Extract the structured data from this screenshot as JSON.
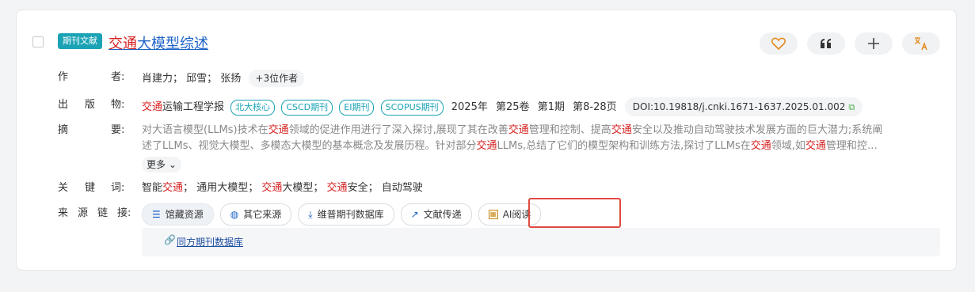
{
  "doc_type": "期刊文献",
  "title": {
    "hl": "交通",
    "rest": "大模型综述"
  },
  "actions": [
    {
      "name": "favorite-icon"
    },
    {
      "name": "quote-icon"
    },
    {
      "name": "add-icon"
    },
    {
      "name": "translate-icon"
    }
  ],
  "labels": {
    "author": [
      "作",
      "者:"
    ],
    "publisher": [
      "出",
      "版",
      "物:"
    ],
    "abstract": [
      "摘",
      "要:"
    ],
    "keywords": [
      "关",
      "键",
      "词:"
    ],
    "sources": [
      "来",
      "源",
      "链",
      "接:"
    ]
  },
  "authors": {
    "list": "肖建力； 邱雪； 张扬",
    "more": "+3位作者"
  },
  "publication": {
    "journal_hl": "交通",
    "journal_rest": "运输工程学报",
    "tags": [
      "北大核心",
      "CSCD期刊",
      "EI期刊",
      "SCOPUS期刊"
    ],
    "year": "2025年",
    "volume": "第25卷",
    "issue": "第1期",
    "pages": "第8-28页",
    "doi": "DOI:10.19818/j.cnki.1671-1637.2025.01.002"
  },
  "abstract": {
    "line1_a": "对大语言模型(LLMs)技术在",
    "hl": "交通",
    "line1_b": "领域的促进作用进行了深入探讨,展现了其在改善",
    "line1_c": "管理和控制、提高",
    "line1_d": "安全以及推动自动驾驶技术发展方面的巨大潜力;系统阐",
    "line2_a": "述了LLMs、视觉大模型、多模态大模型的基本概念及发展历程。针对部分",
    "line2_b": "LLMs,总结了它们的模型架构和训练方法,探讨了LLMs在",
    "line2_c": "领域,如",
    "line2_d": "管理和控…",
    "more": "更多"
  },
  "keywords": {
    "k1a": "智能",
    "k1b": "交通",
    "sep": "；",
    "k2": "通用大模型",
    "k3a": "交通",
    "k3b": "大模型",
    "k4a": "交通",
    "k4b": "安全",
    "k5": "自动驾驶"
  },
  "source_links": [
    {
      "label": "馆藏资源",
      "icon": "library-icon"
    },
    {
      "label": "其它来源",
      "icon": "globe-icon"
    },
    {
      "label": "维普期刊数据库",
      "icon": "download-icon"
    },
    {
      "label": "文献传递",
      "icon": "arrow-icon"
    },
    {
      "label": "AI阅读",
      "icon": "ai-read-icon"
    }
  ],
  "panel_link": "同方期刊数据库",
  "colors": {
    "accent": "#1aa3b5",
    "highlight": "#d61f1f",
    "link": "#1c62c7",
    "callout": "#e04b3f"
  }
}
